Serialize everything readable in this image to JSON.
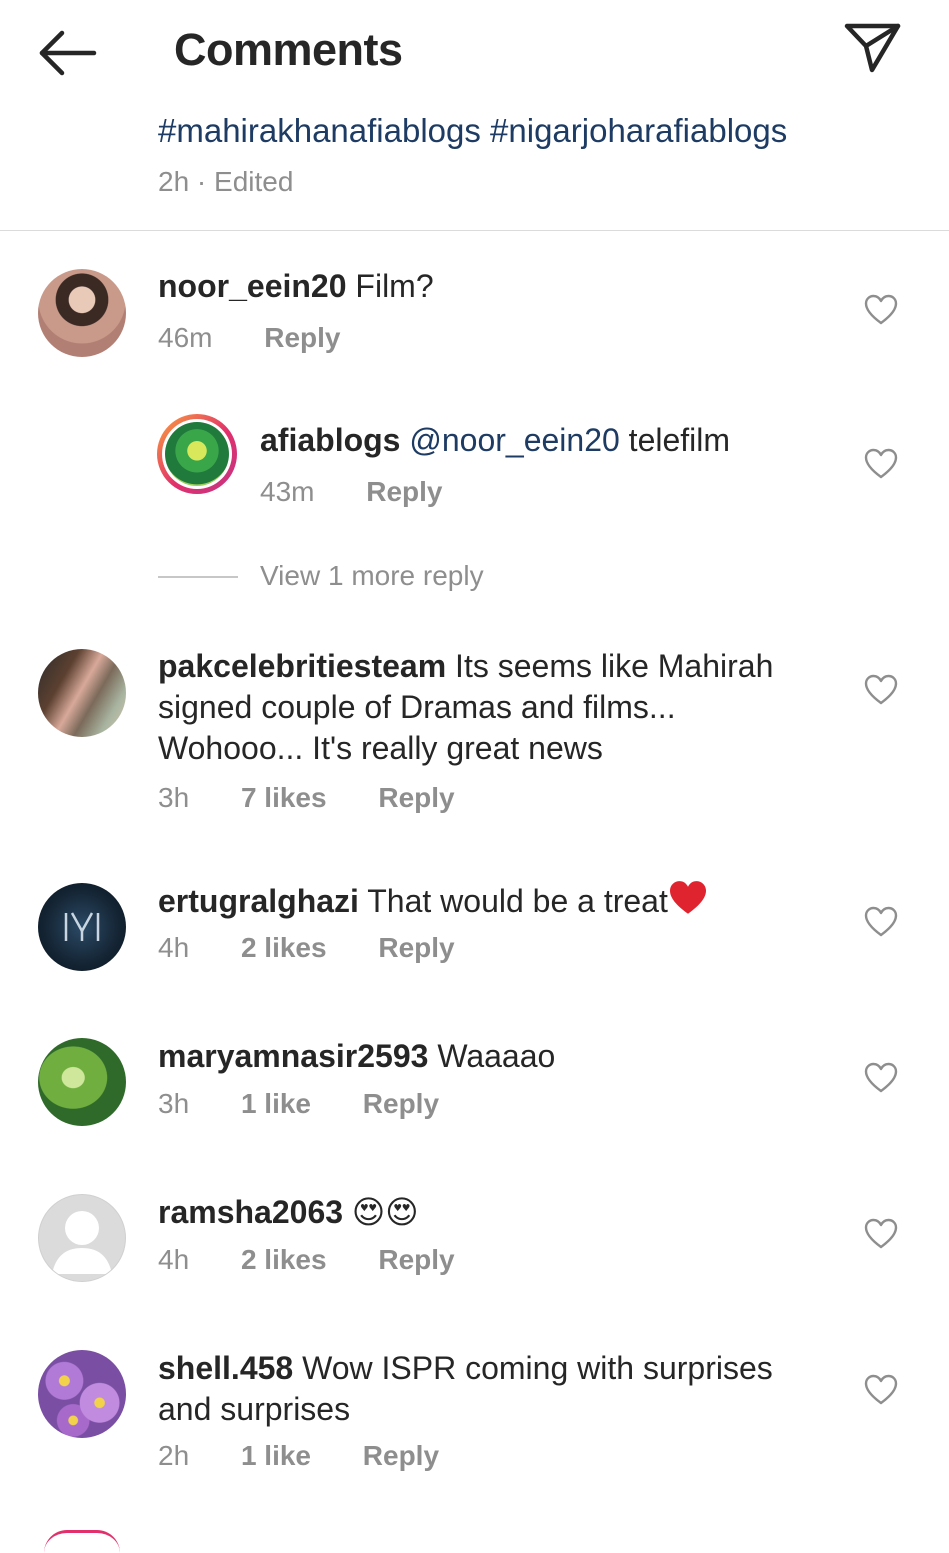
{
  "header": {
    "title": "Comments",
    "back_icon": "arrow-left-icon",
    "send_icon": "paper-plane-icon"
  },
  "caption": {
    "hashtags": "#mahirakhanafiablogs #nigarjoharafiablogs",
    "meta": "2h · Edited"
  },
  "comments": [
    {
      "user": "noor_eein20",
      "text": "Film?",
      "time": "46m",
      "likes": "",
      "reply": "Reply"
    },
    {
      "user": "afiablogs",
      "mention": "@noor_eein20",
      "text": "telefilm",
      "time": "43m",
      "likes": "",
      "reply": "Reply"
    },
    {
      "user": "pakcelebritiesteam",
      "text": "Its seems like Mahirah signed couple of Dramas and films... Wohooo... It's really great news",
      "time": "3h",
      "likes": "7 likes",
      "reply": "Reply"
    },
    {
      "user": "ertugralghazi",
      "text": "That would be a treat",
      "time": "4h",
      "likes": "2 likes",
      "reply": "Reply"
    },
    {
      "user": "maryamnasir2593",
      "text": "Waaaao",
      "time": "3h",
      "likes": "1 like",
      "reply": "Reply"
    },
    {
      "user": "ramsha2063",
      "text": "😍😍",
      "time": "4h",
      "likes": "2 likes",
      "reply": "Reply"
    },
    {
      "user": "shell.458",
      "text": "Wow ISPR coming with surprises and surprises",
      "time": "2h",
      "likes": "1 like",
      "reply": "Reply"
    }
  ],
  "view_more_replies": "View 1 more reply",
  "colors": {
    "text": "#262626",
    "secondary": "#8e8e8e",
    "hashtag": "#1d3b63",
    "divider": "#dbdbdb",
    "story_ring": "#e1306c"
  }
}
